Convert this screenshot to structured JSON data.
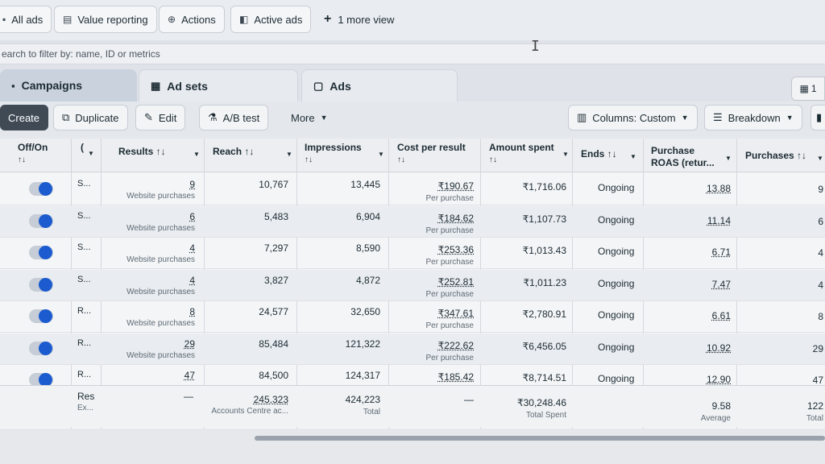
{
  "views": {
    "all_ads": "All ads",
    "value_reporting": "Value reporting",
    "actions": "Actions",
    "active_ads": "Active ads",
    "more_view": "1 more view"
  },
  "search": {
    "placeholder": "earch to filter by: name, ID or metrics"
  },
  "tabs": {
    "campaigns": "Campaigns",
    "ad_sets": "Ad sets",
    "ads": "Ads",
    "right_partial": "1"
  },
  "toolbar": {
    "create": "Create",
    "duplicate": "Duplicate",
    "edit": "Edit",
    "ab_test": "A/B test",
    "more": "More",
    "columns": "Columns: Custom",
    "breakdown": "Breakdown"
  },
  "table": {
    "headers": {
      "off_on": "Off/On",
      "sort_arrows": "↑↓",
      "name_partial": "(",
      "results": "Results ↑↓",
      "reach": "Reach ↑↓",
      "impressions": "Impressions",
      "cost_per_result": "Cost per result",
      "amount_spent": "Amount spent",
      "ends": "Ends ↑↓",
      "purchase_roas_1": "Purchase",
      "purchase_roas_2": "ROAS (retur...",
      "purchases": "Purchases ↑↓"
    },
    "rows": [
      {
        "name": "S...",
        "results": "9",
        "results_label": "Website purchases",
        "reach": "10,767",
        "impressions": "13,445",
        "cost": "₹190.67",
        "cost_label": "Per purchase",
        "spent": "₹1,716.06",
        "ends": "Ongoing",
        "roas": "13.88",
        "purchases": "9"
      },
      {
        "name": "S...",
        "results": "6",
        "results_label": "Website purchases",
        "reach": "5,483",
        "impressions": "6,904",
        "cost": "₹184.62",
        "cost_label": "Per purchase",
        "spent": "₹1,107.73",
        "ends": "Ongoing",
        "roas": "11.14",
        "purchases": "6"
      },
      {
        "name": "S...",
        "results": "4",
        "results_label": "Website purchases",
        "reach": "7,297",
        "impressions": "8,590",
        "cost": "₹253.36",
        "cost_label": "Per purchase",
        "spent": "₹1,013.43",
        "ends": "Ongoing",
        "roas": "6.71",
        "purchases": "4"
      },
      {
        "name": "S...",
        "results": "4",
        "results_label": "Website purchases",
        "reach": "3,827",
        "impressions": "4,872",
        "cost": "₹252.81",
        "cost_label": "Per purchase",
        "spent": "₹1,011.23",
        "ends": "Ongoing",
        "roas": "7.47",
        "purchases": "4"
      },
      {
        "name": "R...",
        "results": "8",
        "results_label": "Website purchases",
        "reach": "24,577",
        "impressions": "32,650",
        "cost": "₹347.61",
        "cost_label": "Per purchase",
        "spent": "₹2,780.91",
        "ends": "Ongoing",
        "roas": "6.61",
        "purchases": "8"
      },
      {
        "name": "R...",
        "results": "29",
        "results_label": "Website purchases",
        "reach": "85,484",
        "impressions": "121,322",
        "cost": "₹222.62",
        "cost_label": "Per purchase",
        "spent": "₹6,456.05",
        "ends": "Ongoing",
        "roas": "10.92",
        "purchases": "29"
      },
      {
        "name": "R...",
        "results": "47",
        "results_label": "",
        "reach": "84,500",
        "impressions": "124,317",
        "cost": "₹185.42",
        "cost_label": "",
        "spent": "₹8,714.51",
        "ends": "Ongoing",
        "roas": "12.90",
        "purchases": "47"
      }
    ],
    "totals": {
      "name_line1": "Res",
      "name_line2": "Ex...",
      "results": "—",
      "reach": "245,323",
      "reach_label": "Accounts Centre ac...",
      "impressions": "424,223",
      "impressions_label": "Total",
      "cost": "—",
      "spent": "₹30,248.46",
      "spent_label": "Total Spent",
      "roas": "9.58",
      "roas_label": "Average",
      "purchases": "122",
      "purchases_label": "Total"
    }
  },
  "colors": {
    "toggle_on": "#1b5bcf",
    "create_bg": "#3f4a55"
  }
}
